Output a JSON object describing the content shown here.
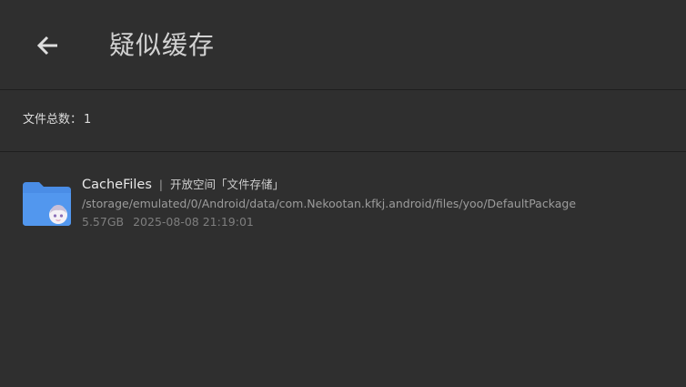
{
  "header": {
    "title": "疑似缓存",
    "back_icon": "arrow-left-icon"
  },
  "summary": {
    "label": "文件总数：",
    "count": "1"
  },
  "files": [
    {
      "name": "CacheFiles",
      "separator": "|",
      "description": "开放空间「文件存储」",
      "path": "/storage/emulated/0/Android/data/com.Nekootan.kfkj.android/files/yoo/DefaultPackage",
      "size": "5.57GB",
      "date": "2025-08-08 21:19:01",
      "icon": "folder-icon"
    }
  ],
  "colors": {
    "background": "#2f2f2f",
    "divider": "#1e1e1e",
    "folder": "#4a8de6"
  }
}
